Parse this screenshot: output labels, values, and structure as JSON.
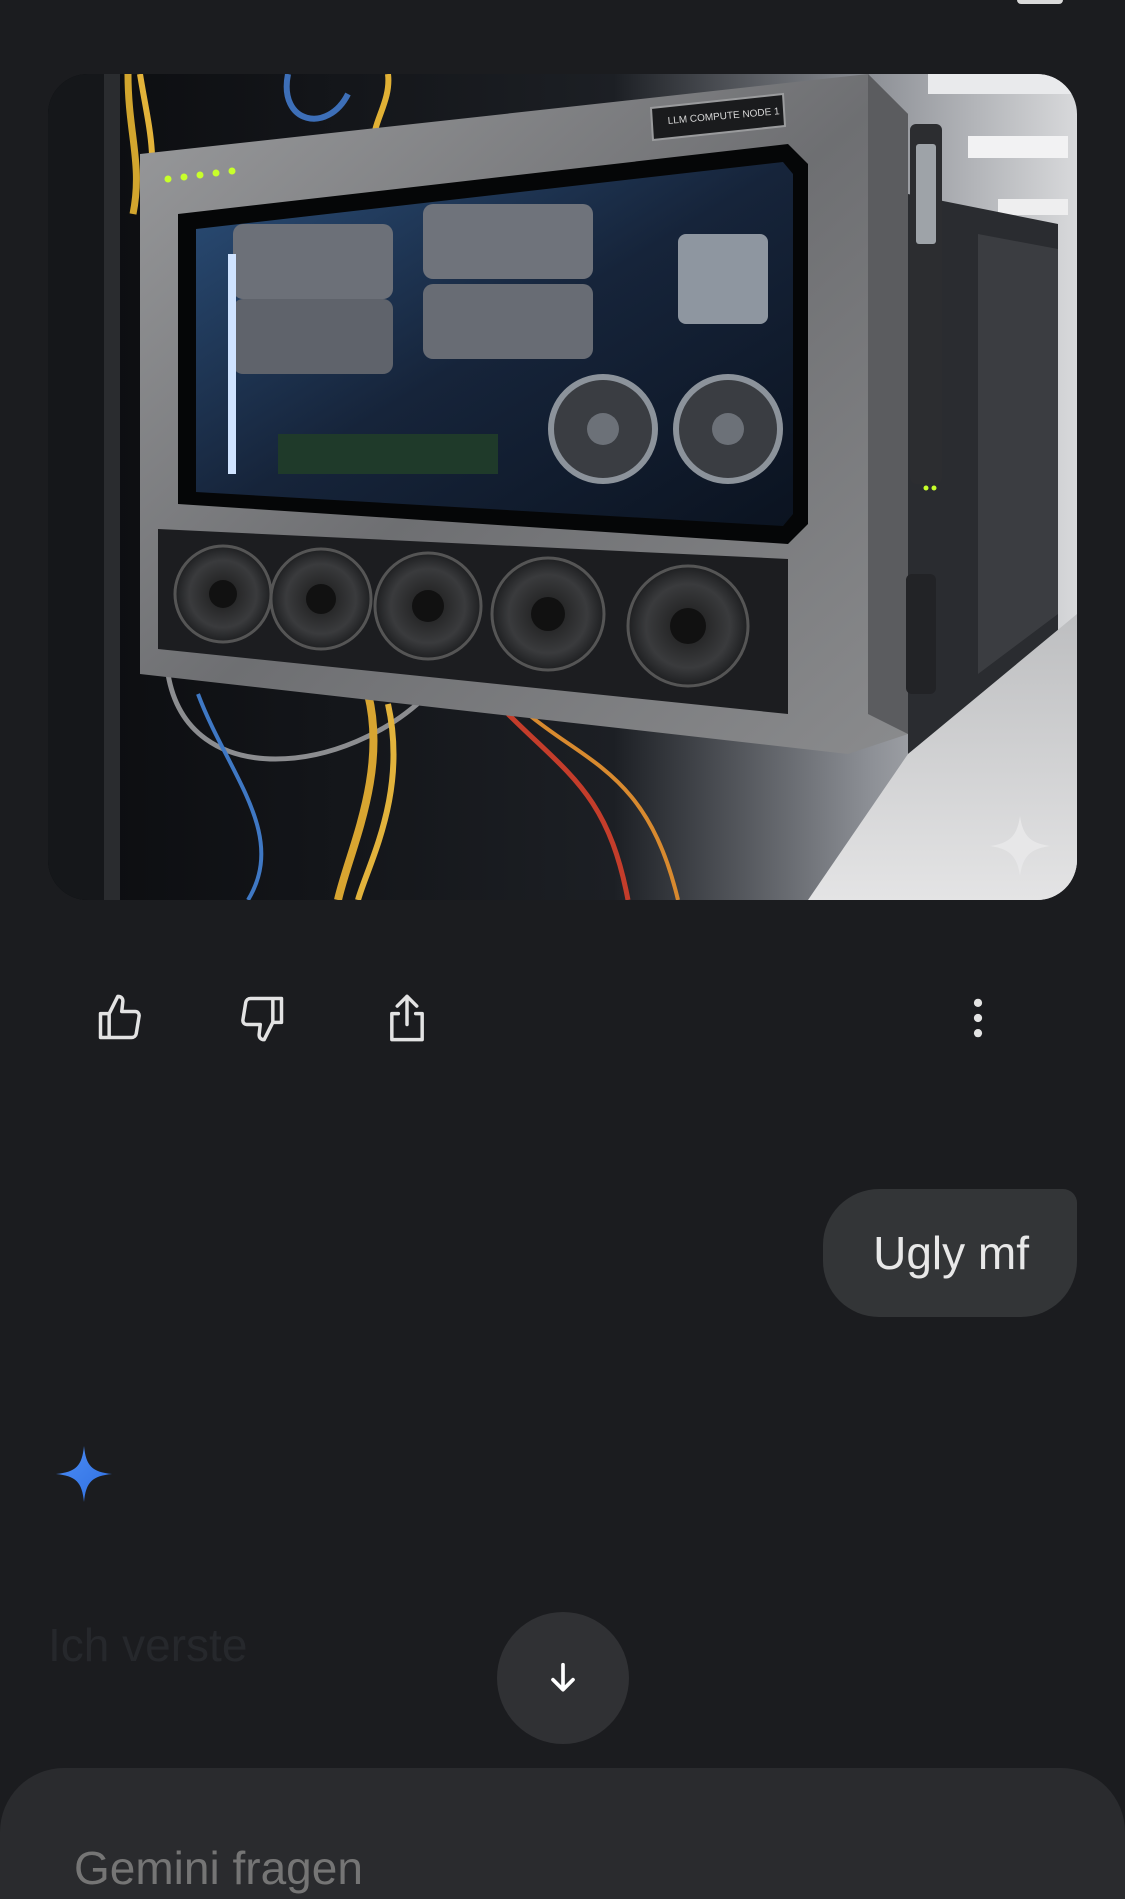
{
  "generated_image": {
    "label_plate": "LLM COMPUTE NODE 1",
    "watermark_icon": "sparkle-icon"
  },
  "actions": {
    "thumbs_up_icon": "thumbs-up-icon",
    "thumbs_down_icon": "thumbs-down-icon",
    "share_icon": "share-icon",
    "more_icon": "more-vert-icon"
  },
  "conversation": {
    "user_message": "Ugly mf",
    "assistant_partial": "Ich verste"
  },
  "scroll_button_icon": "arrow-down-icon",
  "composer": {
    "placeholder": "Gemini fragen"
  },
  "colors": {
    "background": "#1b1c1f",
    "bubble": "#333537",
    "gemini_blue": "#4285f4"
  }
}
